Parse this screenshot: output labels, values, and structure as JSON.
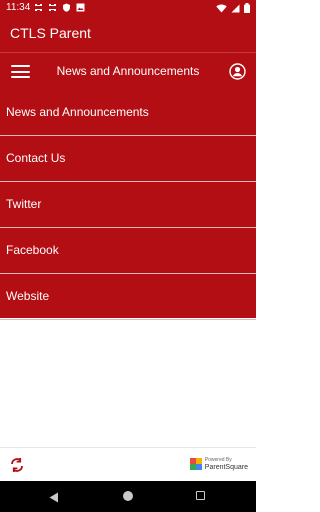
{
  "status_bar": {
    "time": "11:34",
    "icons": [
      "notification-icon",
      "notification-icon",
      "shield-icon",
      "image-icon",
      "wifi-icon",
      "signal-icon",
      "battery-icon"
    ]
  },
  "app": {
    "title": "CTLS Parent"
  },
  "nav": {
    "title": "News and Announcements"
  },
  "menu": {
    "items": [
      {
        "label": "News and Announcements"
      },
      {
        "label": "Contact Us"
      },
      {
        "label": "Twitter"
      },
      {
        "label": "Facebook"
      },
      {
        "label": "Website"
      }
    ]
  },
  "footer": {
    "powered_by": "Powered By",
    "brand": "ParentSquare"
  },
  "colors": {
    "brand": "#b30e13",
    "divider": "#e7b6b8",
    "background": "#ffffff"
  }
}
